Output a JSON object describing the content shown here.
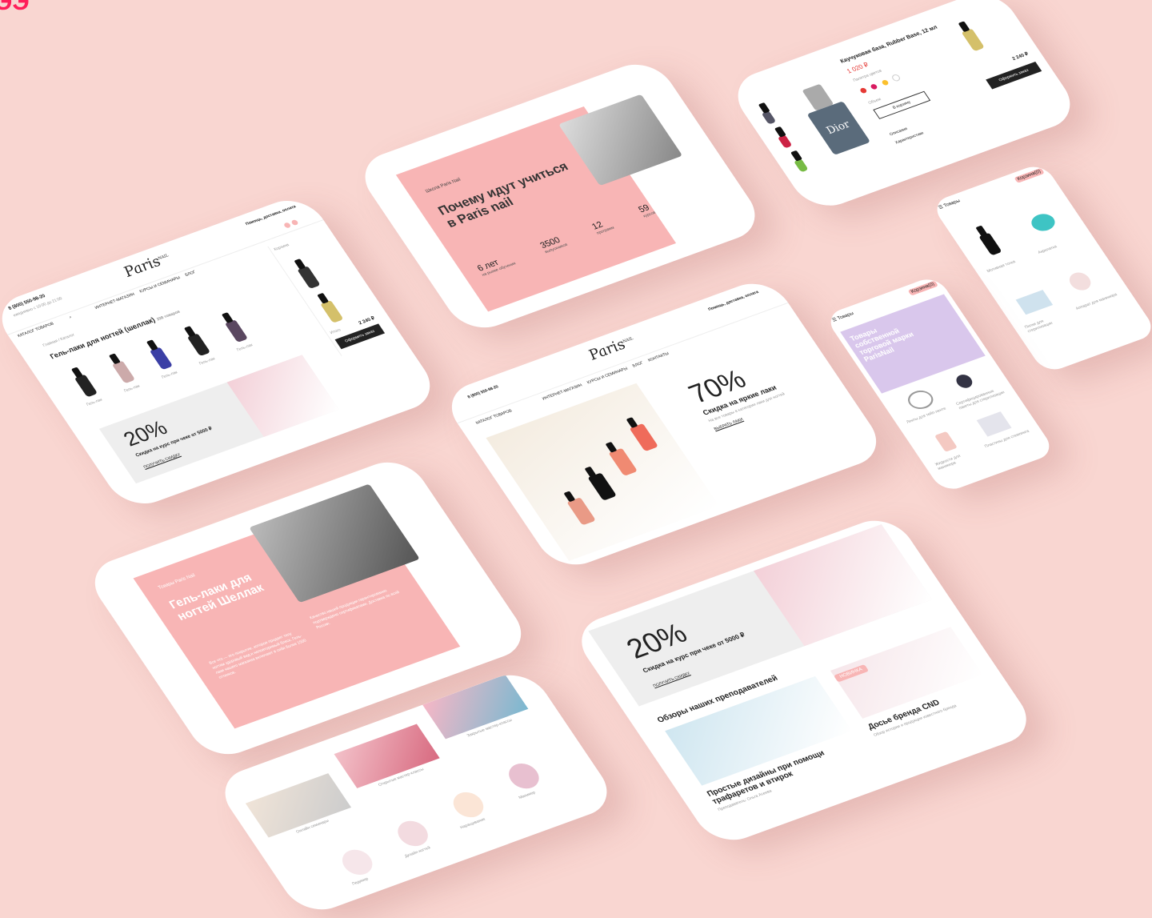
{
  "brand": {
    "logo": "Paris",
    "logo_sub": "NAIL",
    "corner_mark": "ЭЭ"
  },
  "header": {
    "phone": "8 (800) 550-98-20",
    "hours": "ежедневно с 10:00 до 21:00",
    "delivery": "Помощь, доставка, оплата",
    "catalog_button": "КАТАЛОГ ТОВАРОВ",
    "nav": [
      "ИНТЕРНЕТ-МАГАЗИН",
      "КУРСЫ И СЕМИНАРЫ",
      "БЛОГ",
      "ОБУЧЕНИЕ",
      "О НАС",
      "КОНТАКТЫ"
    ],
    "search_icon": "search-icon",
    "cart_label": "Корзина"
  },
  "screen_catalog": {
    "breadcrumb": "Главная / Каталог",
    "title": "Гель-лаки для ногтей (шеллак)",
    "count": "298 товаров",
    "products": [
      "Гель-лак",
      "Гель-лак",
      "Гель-лак",
      "Гель-лак",
      "Гель-лак"
    ],
    "promo_pct": "20%",
    "promo_text": "Скидка на курс при чеке от 5000 ₽",
    "promo_link": "ПОЛУЧИТЬ СКИДКУ",
    "cart_title": "Корзина",
    "cart_total_label": "Итого",
    "cart_total": "2 240 ₽",
    "checkout": "Оформить заказ"
  },
  "screen_why": {
    "eyebrow": "Школа Paris Nail",
    "title": "Почему идут учиться в Paris nail",
    "stats": [
      {
        "value": "6 лет",
        "label": "на рынке обучения"
      },
      {
        "value": "3500",
        "label": "выпускников"
      },
      {
        "value": "12",
        "label": "программ"
      },
      {
        "value": "59",
        "label": "курсов"
      }
    ]
  },
  "screen_product": {
    "title": "Каучуковая база, Rubber Base, 12 мл",
    "price": "1 020 ₽",
    "colors_label": "Палитра цветов",
    "volume_label": "Объем",
    "add_to_cart": "В корзину",
    "description": "Описание",
    "specs": "Характеристики",
    "bottle_brand": "Dior",
    "cart_total": "2 240 ₽",
    "checkout": "Оформить заказ",
    "swatches": [
      "#e53935",
      "#d81b60",
      "#fbc02d",
      "#ffffff"
    ]
  },
  "screen_mobile_a": {
    "menu_label": "Товары",
    "cart": "Корзина(0)",
    "items": [
      "Мотивная точка",
      "Акрилатка",
      "Пилки для стерилизации",
      "Аппарат для маникюра"
    ]
  },
  "screen_mobile_b": {
    "menu_label": "Товары",
    "cart": "Корзина(0)",
    "hero": "Товары собственной торговой марки ParisNail",
    "items": [
      "Ленты для тейп-ленте",
      "Сертифицированные пакеты для стерилизации",
      "Жидкости для маникюра",
      "Пластины для стемпинга"
    ]
  },
  "screen_home": {
    "pct": "70%",
    "text": "Скидка на яркие лаки",
    "sub": "На все товары в категории лаки для ногтей",
    "btn": "ВЫБРАТЬ ЛАКИ"
  },
  "screen_shellac": {
    "eyebrow": "Товары Paris Nail",
    "title": "Гель-лаки для ногтей Шеллак",
    "p1": "Все что — это покрытие, которое придает телу ногтям здоровый вид и неповторимый блеск. Гель-лаки нашего магазина включают в себя более 1500 оттенков.",
    "p2": "Качество нашей продукции гарантированно подтверждено сертификатами. Доставка по всей России."
  },
  "screen_blog": {
    "pct": "20%",
    "promo": "Скидка на курс при чеке от 5000 ₽",
    "link": "ПОЛУЧИТЬ СКИДКУ",
    "section": "Обзоры наших преподавателей",
    "post1": "Простые дизайны при помощи трафаретов и втирок",
    "post1_author": "Преподаватель: Ольга Асеева",
    "post2": "Досье бренда CND",
    "post2_sub": "Обзор истории и продукции известного бренда",
    "badge": "НОВИНКА"
  },
  "screen_courses": {
    "items": [
      "Онлайн семинары",
      "Открытые мастер-классы",
      "Закрытые мастер-классы"
    ],
    "circles": [
      "Педикюр",
      "Дизайн ногтей",
      "Наращивание",
      "Маникюр"
    ]
  },
  "colors": {
    "background": "#f9d6d1",
    "pink": "#f8b5b5",
    "accent": "#ff1f5a",
    "dark": "#222222"
  }
}
